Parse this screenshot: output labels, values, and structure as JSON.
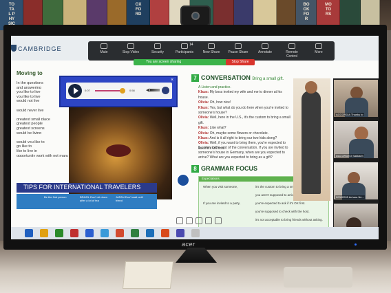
{
  "books": [
    "TOTAL PHYSICS",
    "",
    "",
    "",
    "",
    "",
    "OXFORD",
    "",
    "",
    "",
    "",
    "",
    "",
    "",
    "BOOK FOR",
    "MOTORS",
    "",
    ""
  ],
  "app": {
    "brand": "CAMBRIDGE",
    "toolbar": [
      {
        "label": "Mute",
        "icon": "microphone-icon"
      },
      {
        "label": "Stop Video",
        "icon": "video-camera-icon"
      },
      {
        "label": "Security",
        "icon": "shield-icon"
      },
      {
        "label": "Participants",
        "icon": "people-icon",
        "count": "14"
      },
      {
        "label": "New Share",
        "icon": "share-screen-icon"
      },
      {
        "label": "Pause Share",
        "icon": "pause-icon"
      },
      {
        "label": "Annotate",
        "icon": "pencil-icon"
      },
      {
        "label": "Remote Control",
        "icon": "remote-control-icon"
      },
      {
        "label": "More",
        "icon": "more-icon"
      }
    ],
    "share_status": "You are screen sharing",
    "stop_share": "Stop Share"
  },
  "left_page": {
    "heading": "Moving to",
    "text_lines": [
      "In the questions",
      "and answering",
      "you like to live",
      "you like to live",
      "would not live",
      "",
      "would never live",
      "",
      "greatest small place",
      "greatest people",
      "greatest screens",
      "would be living",
      "",
      "would you like to",
      "go like to",
      "like to live in",
      "opportunity work with not many friends."
    ],
    "tips_heading": "TIPS FOR INTERNATIONAL TRAVELERS",
    "tips_boxes": [
      "Be the first person",
      "BRAZIL Don't sit down after a lot of tea",
      "JAPAN Don't wait until friend"
    ]
  },
  "audio_player": {
    "current_time": "0:07",
    "duration": "0:58"
  },
  "right_page": {
    "section7_num": "7",
    "section7_title": "CONVERSATION",
    "section7_sub": "Bring a small gift.",
    "listen_a": "A  Listen and practice.",
    "dialogue": [
      {
        "speaker": "Klaus:",
        "line": "My boss invited my wife and me to dinner at his house."
      },
      {
        "speaker": "Olivia:",
        "line": "Oh, how nice!"
      },
      {
        "speaker": "Klaus:",
        "line": "Yes, but what do you do here when you're invited to someone's house?"
      },
      {
        "speaker": "Olivia:",
        "line": "Well, here in the U.S., it's the custom to bring a small gift."
      },
      {
        "speaker": "Klaus:",
        "line": "Like what?"
      },
      {
        "speaker": "Olivia:",
        "line": "Oh, maybe some flowers or chocolate."
      },
      {
        "speaker": "Klaus:",
        "line": "And is it all right to bring our two kids along?"
      },
      {
        "speaker": "Olivia:",
        "line": "Well, if you want to bring them, you're expected to ask if it's OK first."
      }
    ],
    "listen_b": "B  Listen to the rest of the conversation. If you are invited to someone's house in Germany, when are you expected to arrive? What are you expected to bring as a gift?",
    "section8_num": "8",
    "section8_title": "GRAMMAR FOCUS",
    "grammar_bar": "Expectations",
    "grammar_rows": [
      {
        "left": "When you visit someone,",
        "right": "it's the custom to bring a small gift."
      },
      {
        "left": "",
        "right": "you aren't supposed to arrive early."
      },
      {
        "left": "If you are invited to a party,",
        "right": "you're expected to ask if it's OK first."
      },
      {
        "left": "",
        "right": "you're supposed to check with the host."
      },
      {
        "left": "",
        "right": "it's not acceptable to bring friends without asking."
      }
    ]
  },
  "gallery": [
    {
      "name": "ACCORDIA Thanks to"
    },
    {
      "name": "DACORDEO Sakkarin"
    },
    {
      "name": "00002005 Achara Ne..."
    },
    {
      "name": ""
    }
  ],
  "monitor_brand": "acer"
}
